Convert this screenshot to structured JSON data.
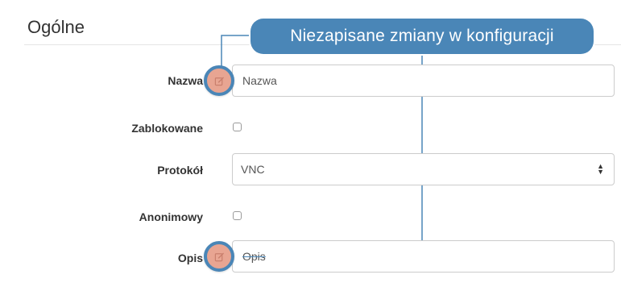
{
  "section": {
    "title": "Ogólne"
  },
  "callout": {
    "text": "Niezapisane zmiany w konfiguracji"
  },
  "fields": {
    "name": {
      "label": "Nazwa",
      "value": "Nazwa"
    },
    "locked": {
      "label": "Zablokowane",
      "checked": false
    },
    "protocol": {
      "label": "Protokół",
      "selected": "VNC"
    },
    "anonymous": {
      "label": "Anonimowy",
      "checked": false
    },
    "description": {
      "label": "Opis",
      "value": "Opis"
    }
  },
  "icons": {
    "unsaved_marker": "edit-icon",
    "select_arrows": "sort-arrows-icon"
  },
  "colors": {
    "accent": "#4a86b7",
    "marker_fill": "#e8a592"
  }
}
